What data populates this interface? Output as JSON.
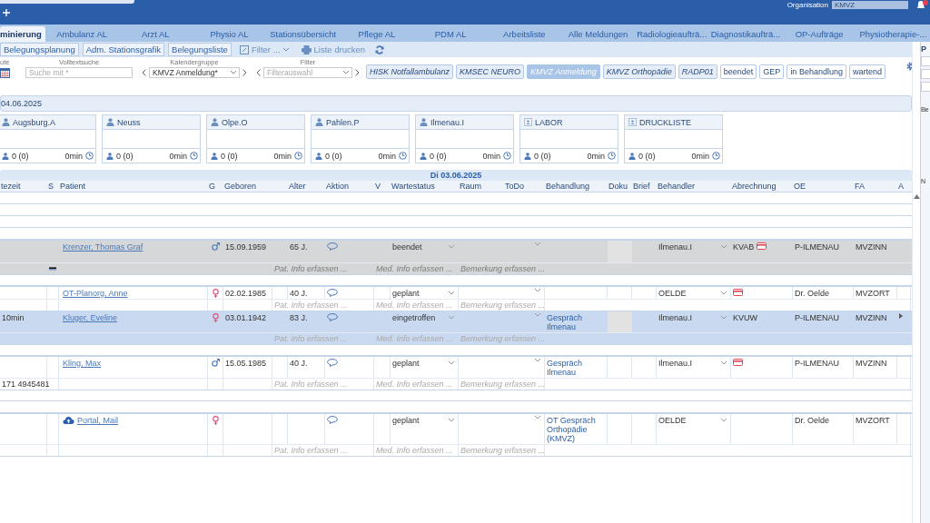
{
  "top_bar": {
    "organisation_label": "Organisation",
    "organisation_value": "KMVZ"
  },
  "tabs": [
    {
      "label": "minierung",
      "selected": true
    },
    {
      "label": "Ambulanz AL",
      "selected": false
    },
    {
      "label": "Arzt AL",
      "selected": false
    },
    {
      "label": "Physio AL",
      "selected": false
    },
    {
      "label": "Stationsübersicht",
      "selected": false
    },
    {
      "label": "Pflege AL",
      "selected": false
    },
    {
      "label": "PDM AL",
      "selected": false
    },
    {
      "label": "Arbeitsliste",
      "selected": false
    },
    {
      "label": "Alle Meldungen",
      "selected": false
    },
    {
      "label": "Radiologieaufträ...",
      "selected": false
    },
    {
      "label": "Diagnostikaufträ...",
      "selected": false
    },
    {
      "label": "OP-Aufträge",
      "selected": false
    },
    {
      "label": "Physiotherapie-...",
      "selected": false
    }
  ],
  "toolbar": {
    "buttons": [
      "Belegungsplanung",
      "Adm. Stationsgrafik",
      "Belegungsliste"
    ],
    "filter": "Filter ...",
    "print": "Liste drucken"
  },
  "filters": {
    "date_label": "ute",
    "search_label": "Volltextsuche",
    "search": {
      "placeholder": "Suche mit *"
    },
    "group_label": "Kalendergruppe",
    "group_value": "KMVZ Anmeldung*",
    "filter_label": "Filter",
    "filter": {
      "placeholder": "Filterauswahl"
    }
  },
  "tags": [
    {
      "label": "HISK Notfallambulanz",
      "kind": "calendar",
      "selected": false
    },
    {
      "label": "KMSEC NEURO",
      "kind": "calendar",
      "selected": false
    },
    {
      "label": "KMVZ Anmeldung",
      "kind": "calendar",
      "selected": true
    },
    {
      "label": "KMVZ Orthopädie",
      "kind": "calendar",
      "selected": false
    },
    {
      "label": "RADP01",
      "kind": "calendar",
      "selected": false
    },
    {
      "label": "beendet",
      "kind": "status",
      "selected": false
    },
    {
      "label": "GEP",
      "kind": "status",
      "selected": false
    },
    {
      "label": "in Behandlung",
      "kind": "status",
      "selected": false
    },
    {
      "label": "wartend",
      "kind": "status",
      "selected": false
    }
  ],
  "date": "04.06.2025",
  "resources": [
    {
      "name": "Augsburg.A",
      "kind": "person",
      "count": "0 (0)",
      "time": "0min"
    },
    {
      "name": "Neuss",
      "kind": "person",
      "count": "0 (0)",
      "time": "0min"
    },
    {
      "name": "Olpe.O",
      "kind": "person",
      "count": "0 (0)",
      "time": "0min"
    },
    {
      "name": "Pahlen.P",
      "kind": "person",
      "count": "0 (0)",
      "time": "0min"
    },
    {
      "name": "Ilmenau.I",
      "kind": "person",
      "count": "0 (0)",
      "time": "0min"
    },
    {
      "name": "LABOR",
      "kind": "room",
      "count": "0 (0)",
      "time": "0min"
    },
    {
      "name": "DRUCKLISTE",
      "kind": "room",
      "count": "0 (0)",
      "time": "0min"
    }
  ],
  "table": {
    "day": "Di 03.06.2025",
    "columns": [
      "tezeit",
      "S",
      "Patient",
      "G",
      "Geboren",
      "Alter",
      "Aktion",
      "V",
      "Wartestatus",
      "Raum",
      "ToDo",
      "Behandlung",
      "Doku",
      "Brief",
      "Behandler",
      "Abrechnung",
      "OE",
      "FA",
      "A"
    ],
    "rows": [
      {
        "kind": "blank"
      },
      {
        "kind": "blank"
      },
      {
        "kind": "blank"
      },
      {
        "kind": "blank"
      },
      {
        "kind": "patient",
        "selected": false,
        "finished": true,
        "s_marked": true,
        "portal": false,
        "name": "Krenzer, Thomas Graf",
        "male": true,
        "born": "15.09.1959",
        "age": "65 J.",
        "wartestatus": "beendet",
        "doku_marked": true,
        "behandler": "Ilmenau.I",
        "abrechnung": "KVAB",
        "billing_card": true,
        "oe": "P-ILMENAU",
        "fa": "MVZINN",
        "arrow": false,
        "pat_info": "Pat. Info erfassen ...",
        "med_info": "Med. Info erfassen ...",
        "bemerkung": "Bemerkung erfassen ..."
      },
      {
        "kind": "blank"
      },
      {
        "kind": "patient",
        "selected": false,
        "finished": false,
        "s_marked": false,
        "portal": false,
        "name": "OT-Planorg, Anne",
        "male": false,
        "born": "02.02.1985",
        "age": "40 J.",
        "wartestatus": "geplant",
        "doku_marked": false,
        "behandler": "OELDE",
        "billing_card": true,
        "oe": "Dr. Oelde",
        "fa": "MVZORT",
        "arrow": false,
        "pat_info": "Pat. Info erfassen ...",
        "med_info": "Med. Info erfassen ...",
        "bemerkung": "Bemerkung erfassen ..."
      },
      {
        "kind": "patient",
        "selected": true,
        "finished": false,
        "s_marked": false,
        "portal": false,
        "time": "10min",
        "name": "Kluger, Eveline",
        "male": false,
        "born": "03.01.1942",
        "age": "83 J.",
        "wartestatus": "eingetroffen",
        "behandlung": "Gespräch Ilmenau",
        "doku_marked": true,
        "behandler": "Ilmenau.I",
        "abrechnung": "KVUW",
        "billing_card": false,
        "oe": "P-ILMENAU",
        "fa": "MVZINN",
        "arrow": true,
        "pat_info": "Pat. Info erfassen ...",
        "med_info": "Med. Info erfassen ...",
        "bemerkung": "Bemerkung erfassen ..."
      },
      {
        "kind": "blank"
      },
      {
        "kind": "patient",
        "selected": false,
        "finished": false,
        "s_marked": false,
        "portal": false,
        "phone": "171 4945481",
        "name": "Kling, Max",
        "male": true,
        "born": "15.05.1985",
        "age": "40 J.",
        "wartestatus": "geplant",
        "behandlung": "Gespräch Ilmenau",
        "doku_marked": false,
        "behandler": "Ilmenau.I",
        "billing_card": true,
        "oe": "P-ILMENAU",
        "fa": "MVZINN",
        "arrow": false,
        "pat_info": "Pat. Info erfassen ...",
        "med_info": "Med. Info erfassen ...",
        "bemerkung": "Bemerkung erfassen ..."
      },
      {
        "kind": "blank"
      },
      {
        "kind": "blank"
      },
      {
        "kind": "patient",
        "selected": false,
        "finished": false,
        "s_marked": false,
        "portal": true,
        "name": "Portal, Mail",
        "male": false,
        "wartestatus": "geplant",
        "behandlung": "OT Gespräch Orthopädie (KMVZ)",
        "doku_marked": false,
        "behandler": "OELDE",
        "billing_card": false,
        "oe": "Dr. Oelde",
        "fa": "MVZORT",
        "arrow": false,
        "pat_info": "Pat. Info erfassen ...",
        "med_info": "Med. Info erfassen ...",
        "bemerkung": "Bemerkung erfassen ..."
      }
    ]
  },
  "side_panel": {
    "texts": [
      "P",
      "Be",
      "N"
    ]
  }
}
